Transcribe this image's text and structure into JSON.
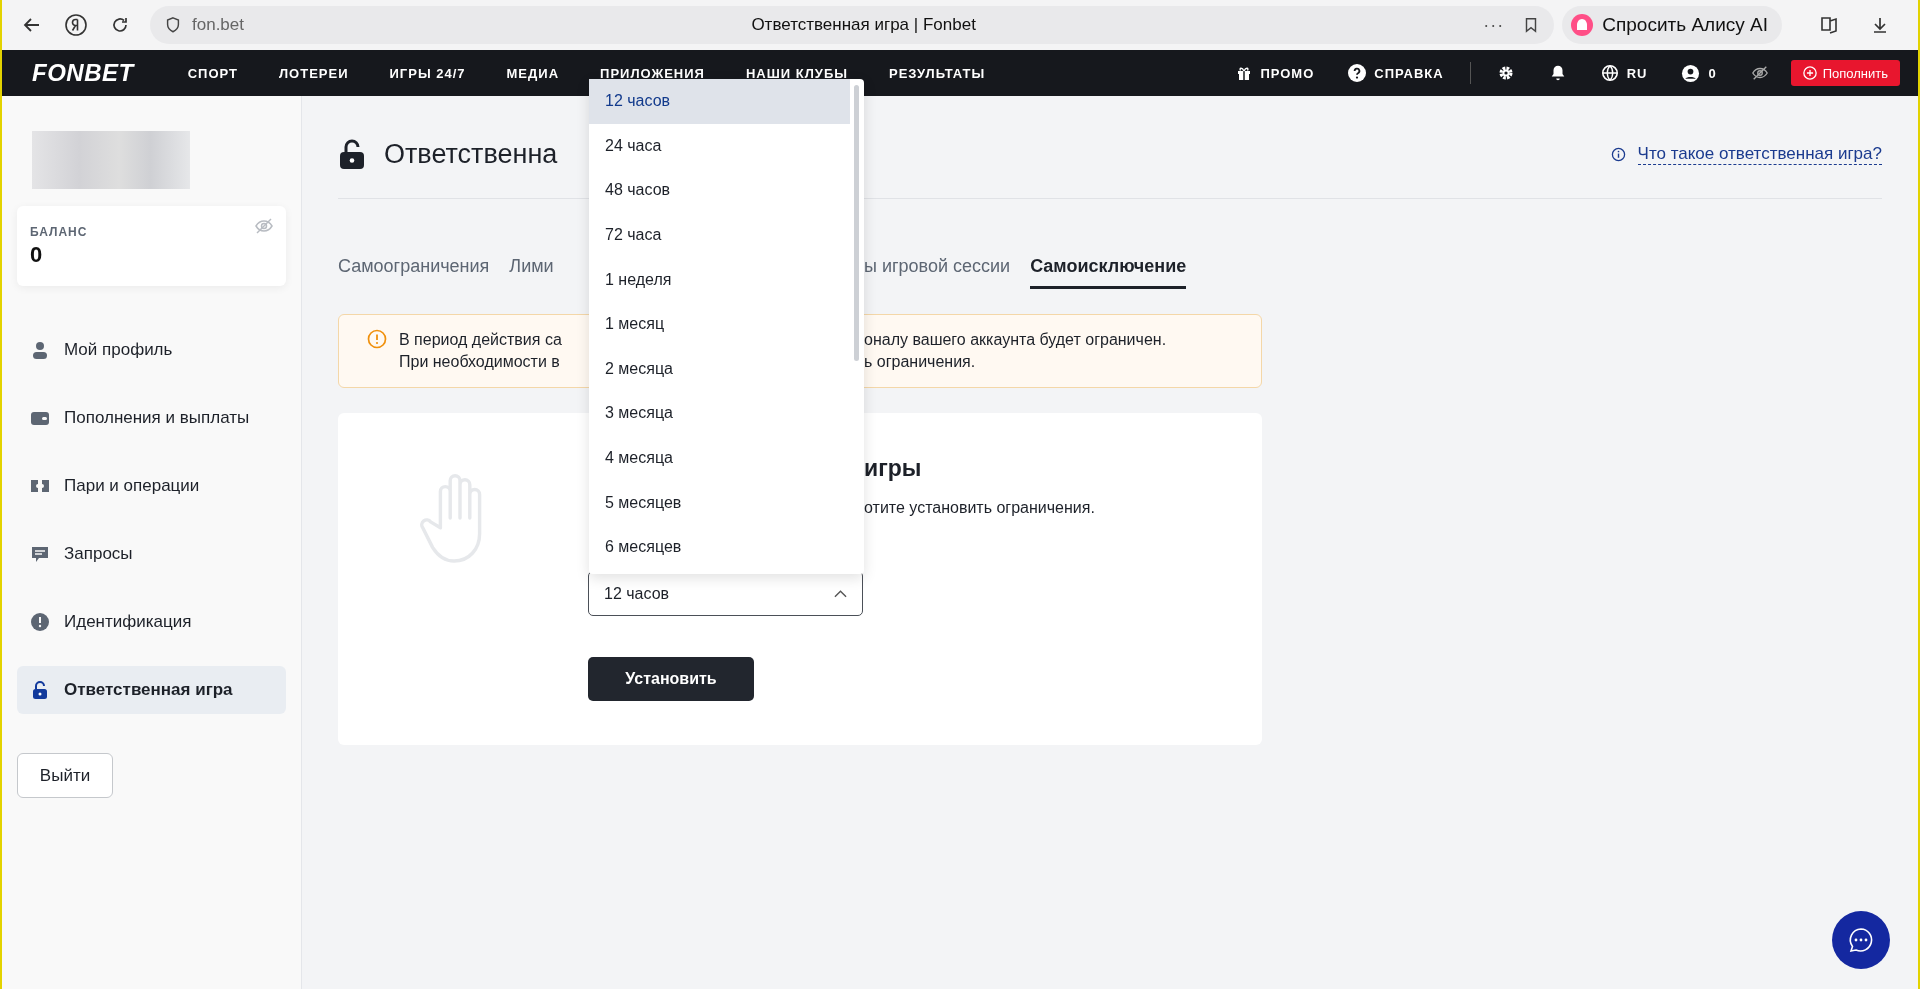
{
  "browser": {
    "url": "fon.bet",
    "tab_title": "Ответственная игра | Fonbet",
    "more": "···",
    "alice_button": "Спросить Алису AI"
  },
  "nav": {
    "logo": "FONBET",
    "items": [
      "СПОРТ",
      "ЛОТЕРЕИ",
      "ИГРЫ 24/7",
      "МЕДИА",
      "ПРИЛОЖЕНИЯ",
      "НАШИ КЛУБЫ",
      "РЕЗУЛЬТАТЫ"
    ],
    "promo": "ПРОМО",
    "help": "СПРАВКА",
    "language": "RU",
    "account_balance": "0",
    "deposit_button": "Пополнить"
  },
  "sidebar": {
    "balance_label": "БАЛАНС",
    "balance_value": "0",
    "menu": [
      {
        "label": "Мой профиль",
        "kind": "person",
        "selected": false
      },
      {
        "label": "Пополнения и выплаты",
        "kind": "wallet",
        "selected": false
      },
      {
        "label": "Пари и операции",
        "kind": "ticket",
        "selected": false
      },
      {
        "label": "Запросы",
        "kind": "chat",
        "selected": false
      },
      {
        "label": "Идентификация",
        "kind": "alert",
        "selected": false
      },
      {
        "label": "Ответственная игра",
        "kind": "lock",
        "selected": true
      }
    ],
    "logout_button": "Выйти"
  },
  "page": {
    "title": "Ответственна",
    "help_link": "Что такое ответственная игра?",
    "tabs_before_menu": [
      {
        "label": "Самоограничения",
        "selected": false
      },
      {
        "label": "Лими",
        "selected": false
      }
    ],
    "tabs_after_menu": [
      {
        "label": "ы игровой сессии",
        "selected": false
      },
      {
        "label": "Самоисключение",
        "selected": true
      }
    ],
    "alert": [
      {
        "before_menu": "В период действия са",
        "after_menu": "оналу вашего аккаунта будет ограничен."
      },
      {
        "before_menu": "При необходимости в",
        "after_menu": "ь ограничения."
      }
    ],
    "card": {
      "heading": "игры",
      "text": "отите установить ограничения."
    },
    "select": {
      "value": "12 часов",
      "expanded": true,
      "options": [
        {
          "label": "12 часов",
          "selected": true
        },
        {
          "label": "24 часа",
          "selected": false
        },
        {
          "label": "48 часов",
          "selected": false
        },
        {
          "label": "72 часа",
          "selected": false
        },
        {
          "label": "1 неделя",
          "selected": false
        },
        {
          "label": "1 месяц",
          "selected": false
        },
        {
          "label": "2 месяца",
          "selected": false
        },
        {
          "label": "3 месяца",
          "selected": false
        },
        {
          "label": "4 месяца",
          "selected": false
        },
        {
          "label": "5 месяцев",
          "selected": false
        },
        {
          "label": "6 месяцев",
          "selected": false
        }
      ]
    },
    "submit_button": "Установить"
  }
}
